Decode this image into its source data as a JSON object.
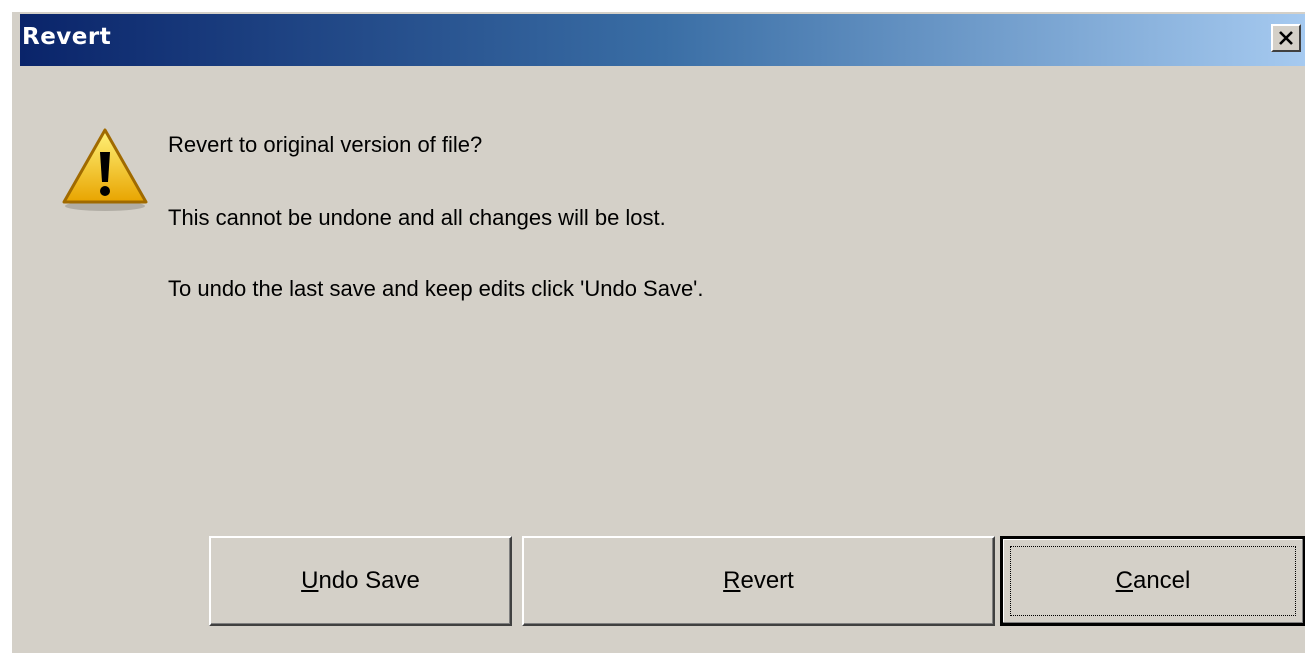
{
  "window": {
    "title": "Revert",
    "close_icon": "close-icon"
  },
  "message": {
    "icon": "warning-icon",
    "line1": "Revert to original version of file?",
    "line2": "This cannot be undone and all changes will be lost.",
    "line3": "To undo the last save and keep edits click 'Undo Save'."
  },
  "buttons": {
    "undo_save": {
      "mnemonic": "U",
      "rest": "ndo Save"
    },
    "revert": {
      "mnemonic": "R",
      "rest": "evert"
    },
    "cancel": {
      "mnemonic": "C",
      "rest": "ancel"
    }
  },
  "colors": {
    "dialog_bg": "#d4d0c8",
    "title_start": "#0a246a",
    "title_end": "#a6caf0",
    "warning_yellow": "#f5c400"
  }
}
